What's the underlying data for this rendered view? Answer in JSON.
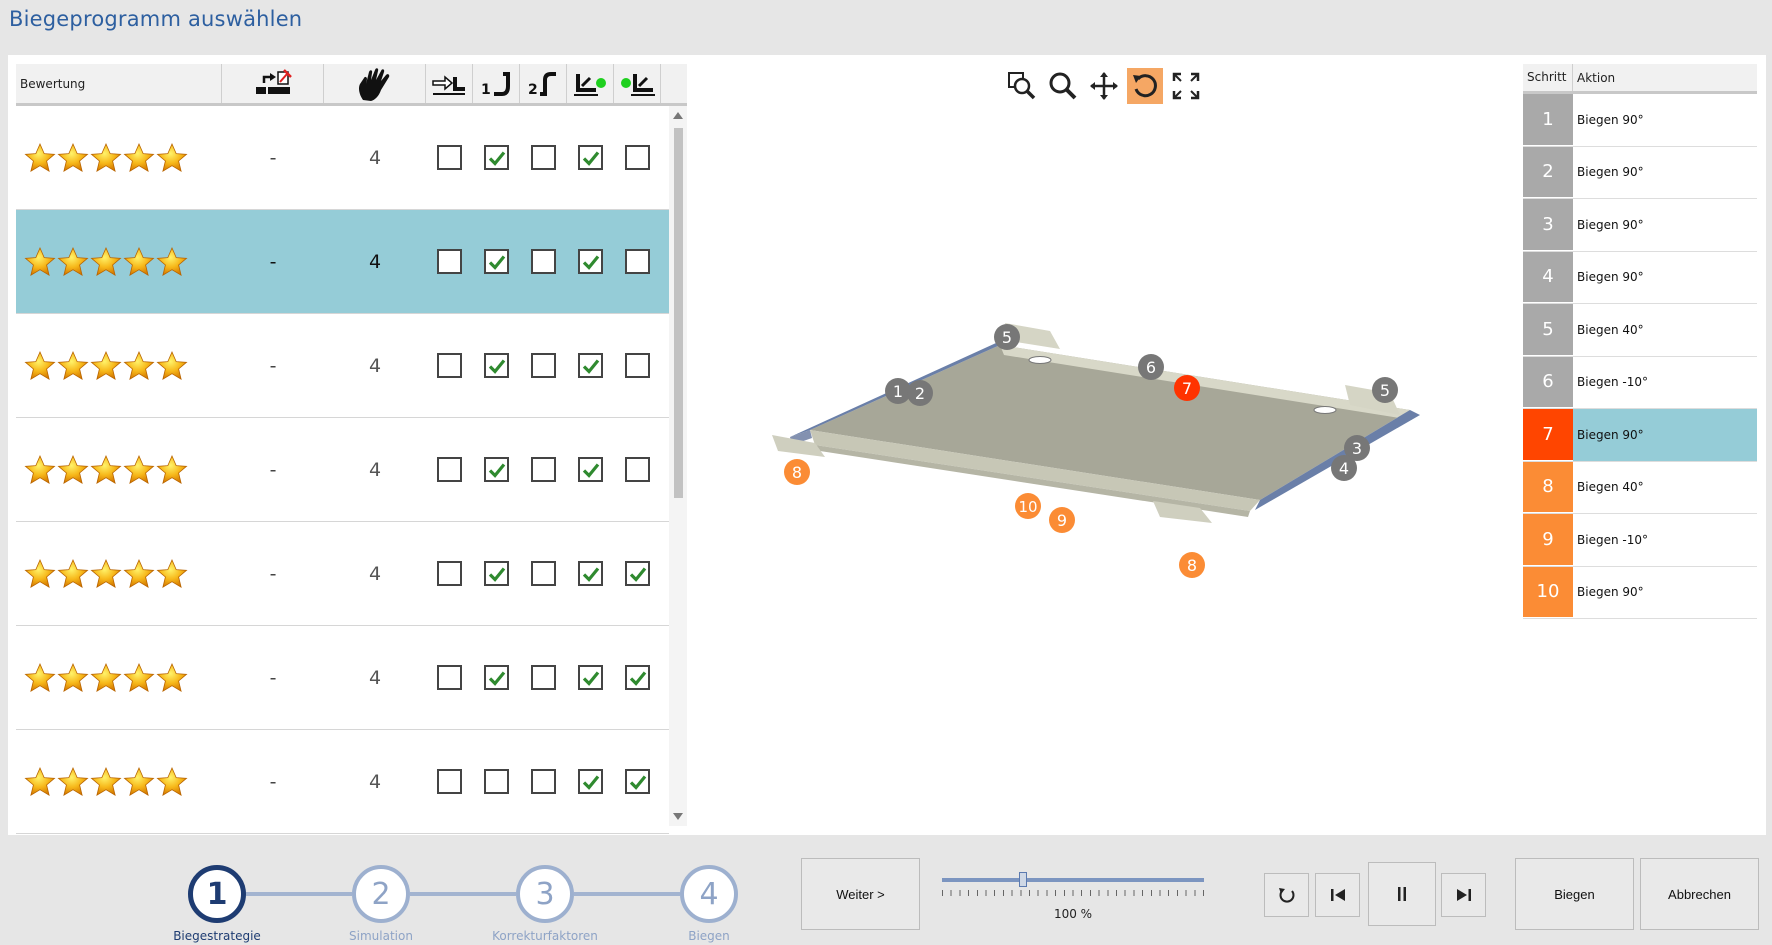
{
  "window": {
    "title": "Biegeprogramm auswählen"
  },
  "strategy_table": {
    "rating_header": "Bewertung",
    "rows": [
      {
        "rating": 5,
        "col1": "-",
        "col2": "4",
        "checks": [
          false,
          true,
          false,
          true,
          false
        ],
        "selected": false
      },
      {
        "rating": 5,
        "col1": "-",
        "col2": "4",
        "checks": [
          false,
          true,
          false,
          true,
          false
        ],
        "selected": true
      },
      {
        "rating": 5,
        "col1": "-",
        "col2": "4",
        "checks": [
          false,
          true,
          false,
          true,
          false
        ],
        "selected": false
      },
      {
        "rating": 5,
        "col1": "-",
        "col2": "4",
        "checks": [
          false,
          true,
          false,
          true,
          false
        ],
        "selected": false
      },
      {
        "rating": 5,
        "col1": "-",
        "col2": "4",
        "checks": [
          false,
          true,
          false,
          true,
          true
        ],
        "selected": false
      },
      {
        "rating": 5,
        "col1": "-",
        "col2": "4",
        "checks": [
          false,
          true,
          false,
          true,
          true
        ],
        "selected": false
      },
      {
        "rating": 5,
        "col1": "-",
        "col2": "4",
        "checks": [
          false,
          false,
          false,
          true,
          true
        ],
        "selected": false
      }
    ]
  },
  "view_toolbar": [
    "zoom-window-icon",
    "zoom-icon",
    "pan-icon",
    "rotate-icon",
    "fit-screen-icon"
  ],
  "view_markers": [
    "1",
    "2",
    "3",
    "4",
    "5",
    "5",
    "6",
    "7",
    "8",
    "8",
    "9",
    "10"
  ],
  "steps_table": {
    "header_step": "Schritt",
    "header_action": "Aktion",
    "steps": [
      {
        "n": "1",
        "action": "Biegen 90°",
        "state": "done"
      },
      {
        "n": "2",
        "action": "Biegen 90°",
        "state": "done"
      },
      {
        "n": "3",
        "action": "Biegen 90°",
        "state": "done"
      },
      {
        "n": "4",
        "action": "Biegen 90°",
        "state": "done"
      },
      {
        "n": "5",
        "action": "Biegen 40°",
        "state": "done"
      },
      {
        "n": "6",
        "action": "Biegen -10°",
        "state": "done"
      },
      {
        "n": "7",
        "action": "Biegen 90°",
        "state": "current"
      },
      {
        "n": "8",
        "action": "Biegen 40°",
        "state": "todo"
      },
      {
        "n": "9",
        "action": "Biegen -10°",
        "state": "todo"
      },
      {
        "n": "10",
        "action": "Biegen 90°",
        "state": "todo"
      }
    ]
  },
  "wizard": {
    "steps": [
      {
        "n": "1",
        "label": "Biegestrategie",
        "active": true
      },
      {
        "n": "2",
        "label": "Simulation",
        "active": false
      },
      {
        "n": "3",
        "label": "Korrekturfaktoren",
        "active": false
      },
      {
        "n": "4",
        "label": "Biegen",
        "active": false
      }
    ]
  },
  "buttons": {
    "next": "Weiter >",
    "bend": "Biegen",
    "cancel": "Abbrechen"
  },
  "speed": {
    "label": "100 %",
    "value": 0.3
  },
  "colors": {
    "selected_row": "#95ccd7",
    "done": "#a9a9a9",
    "current": "#ff4500",
    "todo": "#fb8c35",
    "active_tool": "#f5a764",
    "title": "#2d5fa0"
  }
}
